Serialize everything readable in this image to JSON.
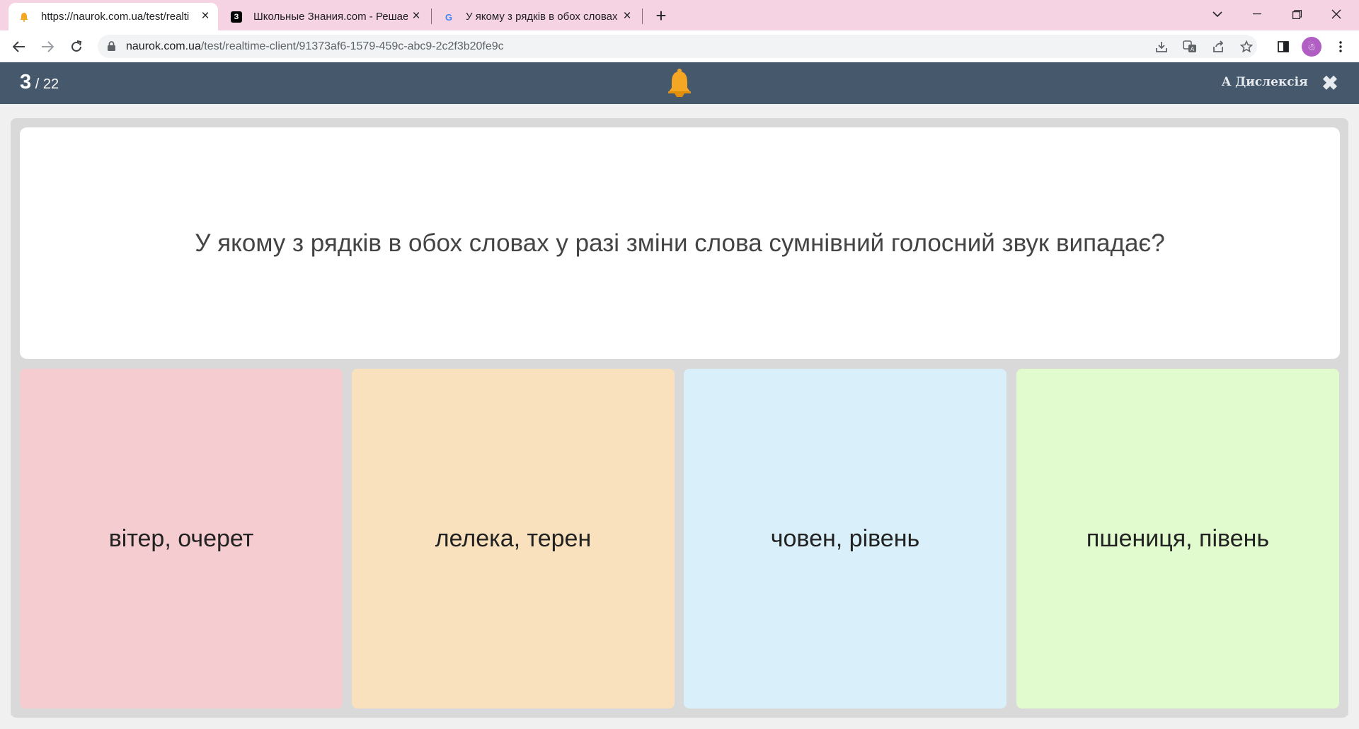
{
  "browser": {
    "tabs": [
      {
        "title": "https://naurok.com.ua/test/realtime-client",
        "favicon": "naurok-bell-icon",
        "active": true
      },
      {
        "title": "Школьные Знания.com - Решаем",
        "favicon": "znanija-icon",
        "active": false
      },
      {
        "title": "У якому з рядків в обох словах",
        "favicon": "google-icon",
        "active": false
      }
    ],
    "url_host": "naurok.com.ua",
    "url_path": "/test/realtime-client/91373af6-1579-459c-abc9-2c2f3b20fe9c"
  },
  "header": {
    "current": "3",
    "total": "/ 22",
    "dyslexia_label": "A Дислексія",
    "bell_color": "#f5a623"
  },
  "question": {
    "text": "У якому з рядків в обох словах у разі зміни слова сумнівний голосний звук випадає?"
  },
  "answers": [
    {
      "text": "вітер, очерет",
      "color": "#f5cccf"
    },
    {
      "text": "лелека, терен",
      "color": "#f9e1bd"
    },
    {
      "text": "човен, рівень",
      "color": "#d9f0fa"
    },
    {
      "text": "пшениця, півень",
      "color": "#e1fbcf"
    }
  ]
}
